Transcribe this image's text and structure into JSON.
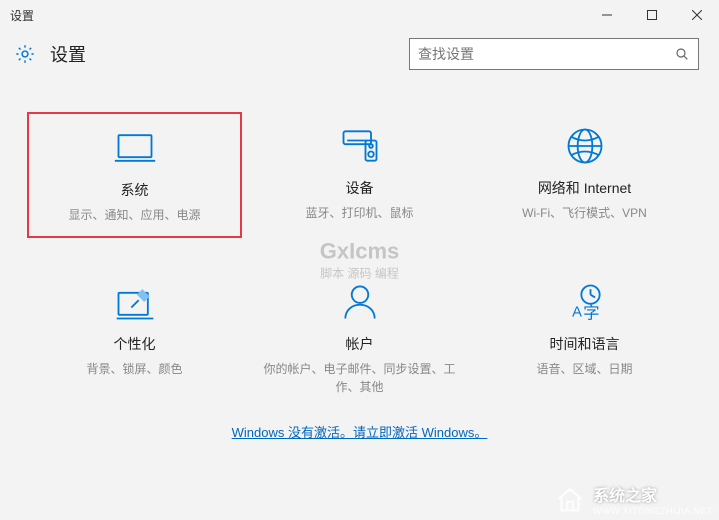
{
  "window": {
    "title": "设置"
  },
  "header": {
    "title": "设置",
    "search_placeholder": "查找设置"
  },
  "tiles": [
    {
      "title": "系统",
      "desc": "显示、通知、应用、电源"
    },
    {
      "title": "设备",
      "desc": "蓝牙、打印机、鼠标"
    },
    {
      "title": "网络和 Internet",
      "desc": "Wi-Fi、飞行模式、VPN"
    },
    {
      "title": "个性化",
      "desc": "背景、锁屏、颜色"
    },
    {
      "title": "帐户",
      "desc": "你的帐户、电子邮件、同步设置、工作、其他"
    },
    {
      "title": "时间和语言",
      "desc": "语音、区域、日期"
    }
  ],
  "activation": {
    "text": "Windows 没有激活。请立即激活 Windows。"
  },
  "watermarks": {
    "center_main": "GxIcms",
    "center_sub": "脚本 源码 编程",
    "corner_main": "系统之家",
    "corner_sub": "WWW.XITONGZHIJIA.NET"
  }
}
